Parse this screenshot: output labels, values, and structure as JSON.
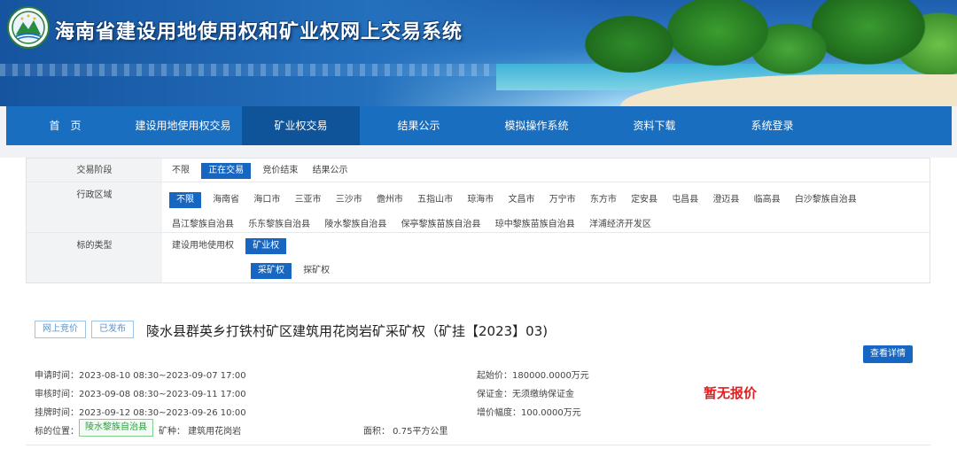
{
  "header": {
    "title": "海南省建设用地使用权和矿业权网上交易系统"
  },
  "nav": {
    "items": [
      "首　页",
      "建设用地使用权交易",
      "矿业权交易",
      "结果公示",
      "模拟操作系统",
      "资料下载",
      "系统登录"
    ],
    "active_index": 2
  },
  "filters": {
    "stage": {
      "label": "交易阶段",
      "options": [
        "不限",
        "正在交易",
        "竞价结束",
        "结果公示"
      ],
      "selected": "正在交易"
    },
    "region": {
      "label": "行政区域",
      "options": [
        "不限",
        "海南省",
        "海口市",
        "三亚市",
        "三沙市",
        "儋州市",
        "五指山市",
        "琼海市",
        "文昌市",
        "万宁市",
        "东方市",
        "定安县",
        "屯昌县",
        "澄迈县",
        "临高县",
        "白沙黎族自治县",
        "昌江黎族自治县",
        "乐东黎族自治县",
        "陵水黎族自治县",
        "保亭黎族苗族自治县",
        "琼中黎族苗族自治县",
        "洋浦经济开发区"
      ],
      "selected": "不限"
    },
    "type": {
      "label": "标的类型",
      "options": [
        "建设用地使用权",
        "矿业权"
      ],
      "selected": "矿业权",
      "sub_options": [
        "采矿权",
        "探矿权"
      ],
      "sub_selected": "采矿权"
    }
  },
  "listing": {
    "tag_online": "网上竞价",
    "tag_published": "已发布",
    "title": "陵水县群英乡打铁村矿区建筑用花岗岩矿采矿权（矿挂【2023】03)",
    "detail_button": "查看详情",
    "apply_time": "申请时间：2023-08-10 08:30~2023-09-07 17:00",
    "review_time": "审核时间：2023-09-08 08:30~2023-09-11 17:00",
    "listing_time": "挂牌时间：2023-09-12 08:30~2023-09-26 10:00",
    "location_label": "标的位置：",
    "location": "陵水黎族自治县",
    "mineral": "矿种：  建筑用花岗岩",
    "area": "面积：  0.75平方公里",
    "start_price": "起始价：180000.0000万元",
    "deposit": "保证金：无须缴纳保证金",
    "increment": "增价幅度：100.0000万元",
    "status": "暂无报价"
  },
  "colors": {
    "nav_bg": "#1a6ebf",
    "nav_active": "#0f5499",
    "selected_bg": "#1767c2",
    "status_red": "#e02020"
  }
}
